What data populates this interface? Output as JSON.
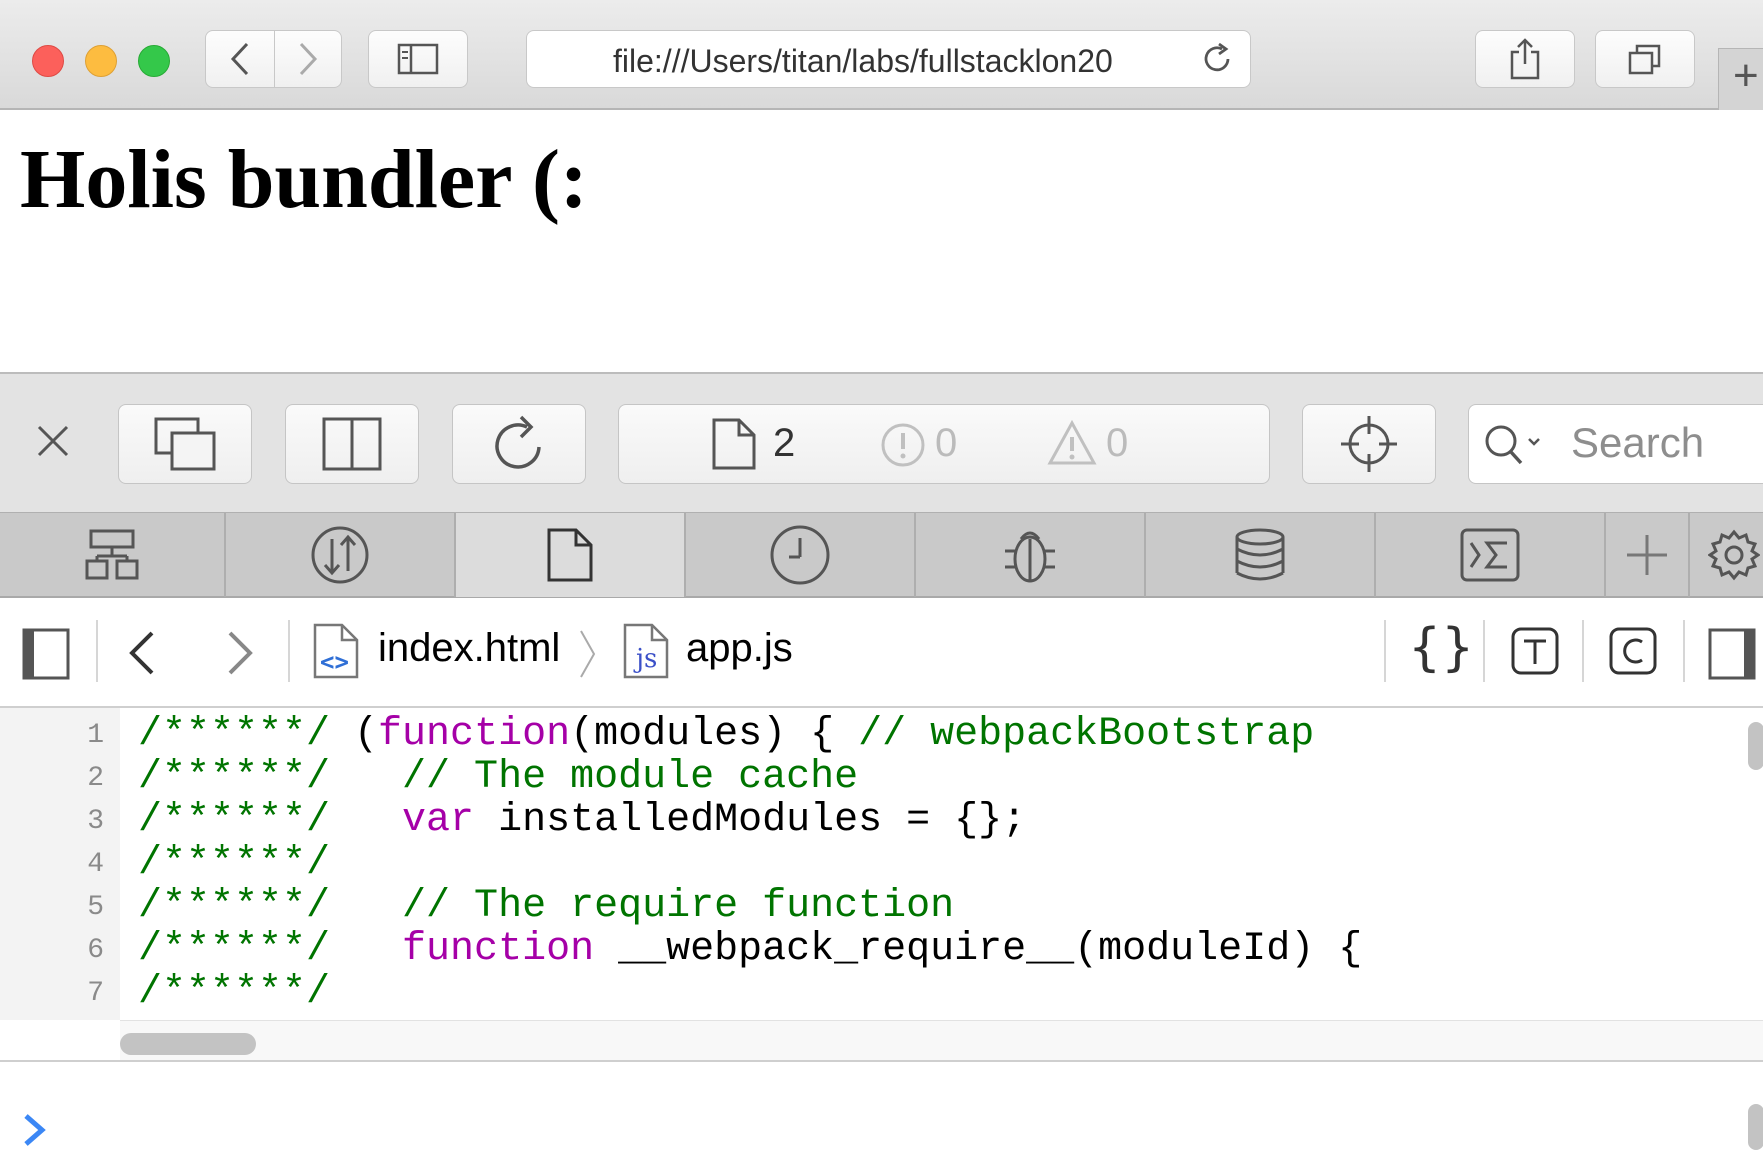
{
  "browser": {
    "url": "file:///Users/titan/labs/fullstacklon20",
    "new_tab_symbol": "+"
  },
  "page": {
    "heading": "Holis bundler (:"
  },
  "inspector": {
    "resource_count": "2",
    "error_count": "0",
    "warning_count": "0",
    "search_placeholder": "Search",
    "tabs": [
      {
        "icon": "elements-icon"
      },
      {
        "icon": "network-icon"
      },
      {
        "icon": "resources-icon",
        "active": true
      },
      {
        "icon": "timelines-icon"
      },
      {
        "icon": "debugger-icon"
      },
      {
        "icon": "storage-icon"
      },
      {
        "icon": "console-icon"
      }
    ],
    "breadcrumb": {
      "file1": "index.html",
      "file1_badge": "<>",
      "file2": "app.js",
      "file2_badge": "js"
    },
    "code": {
      "lines": [
        {
          "n": "1",
          "prefix": "/******/",
          "parts": [
            {
              "t": " (",
              "c": ""
            },
            {
              "t": "function",
              "c": "kw"
            },
            {
              "t": "(modules) { ",
              "c": ""
            },
            {
              "t": "// webpackBootstrap",
              "c": "com"
            }
          ]
        },
        {
          "n": "2",
          "prefix": "/******/",
          "parts": [
            {
              "t": " \t",
              "c": ""
            },
            {
              "t": "// The module cache",
              "c": "com"
            }
          ]
        },
        {
          "n": "3",
          "prefix": "/******/",
          "parts": [
            {
              "t": " \t",
              "c": ""
            },
            {
              "t": "var",
              "c": "kw"
            },
            {
              "t": " installedModules = {};",
              "c": ""
            }
          ]
        },
        {
          "n": "4",
          "prefix": "/******/",
          "parts": []
        },
        {
          "n": "5",
          "prefix": "/******/",
          "parts": [
            {
              "t": " \t",
              "c": ""
            },
            {
              "t": "// The require function",
              "c": "com"
            }
          ]
        },
        {
          "n": "6",
          "prefix": "/******/",
          "parts": [
            {
              "t": " \t",
              "c": ""
            },
            {
              "t": "function",
              "c": "kw"
            },
            {
              "t": " __webpack_require__(moduleId) {",
              "c": ""
            }
          ]
        },
        {
          "n": "7",
          "prefix": "/******/",
          "parts": []
        }
      ]
    },
    "colors": {
      "comment": "#007400",
      "keyword": "#a500a7",
      "prompt": "#3b87f5"
    }
  }
}
